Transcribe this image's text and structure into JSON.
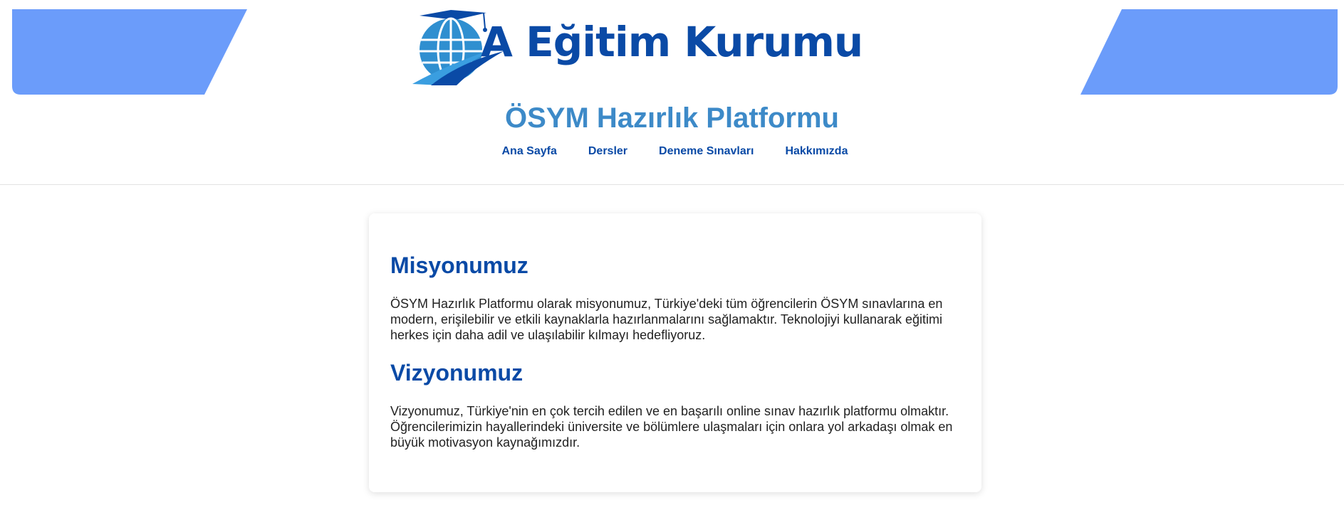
{
  "header": {
    "logo": {
      "brand_text": "A Eğitim Kurumu",
      "icon": "globe-graduation-cap-icon"
    },
    "site_title": "ÖSYM Hazırlık Platformu",
    "nav": [
      {
        "label": "Ana Sayfa"
      },
      {
        "label": "Dersler"
      },
      {
        "label": "Deneme Sınavları"
      },
      {
        "label": "Hakkımızda"
      }
    ]
  },
  "content": {
    "mission": {
      "heading": "Misyonumuz",
      "text": "ÖSYM Hazırlık Platformu olarak misyonumuz, Türkiye'deki tüm öğrencilerin ÖSYM sınavlarına en modern, erişilebilir ve etkili kaynaklarla hazırlanmalarını sağlamaktır. Teknolojiyi kullanarak eğitimi herkes için daha adil ve ulaşılabilir kılmayı hedefliyoruz."
    },
    "vision": {
      "heading": "Vizyonumuz",
      "text": "Vizyonumuz, Türkiye'nin en çok tercih edilen ve en başarılı online sınav hazırlık platformu olmaktır. Öğrencilerimizin hayallerindeki üniversite ve bölümlere ulaşmaları için onlara yol arkadaşı olmak en büyük motivasyon kaynağımızdır."
    }
  },
  "colors": {
    "primary": "#0a4aa6",
    "title": "#3d8ac8",
    "decor": "#6b9cfa",
    "globe": "#2f8fd0"
  }
}
